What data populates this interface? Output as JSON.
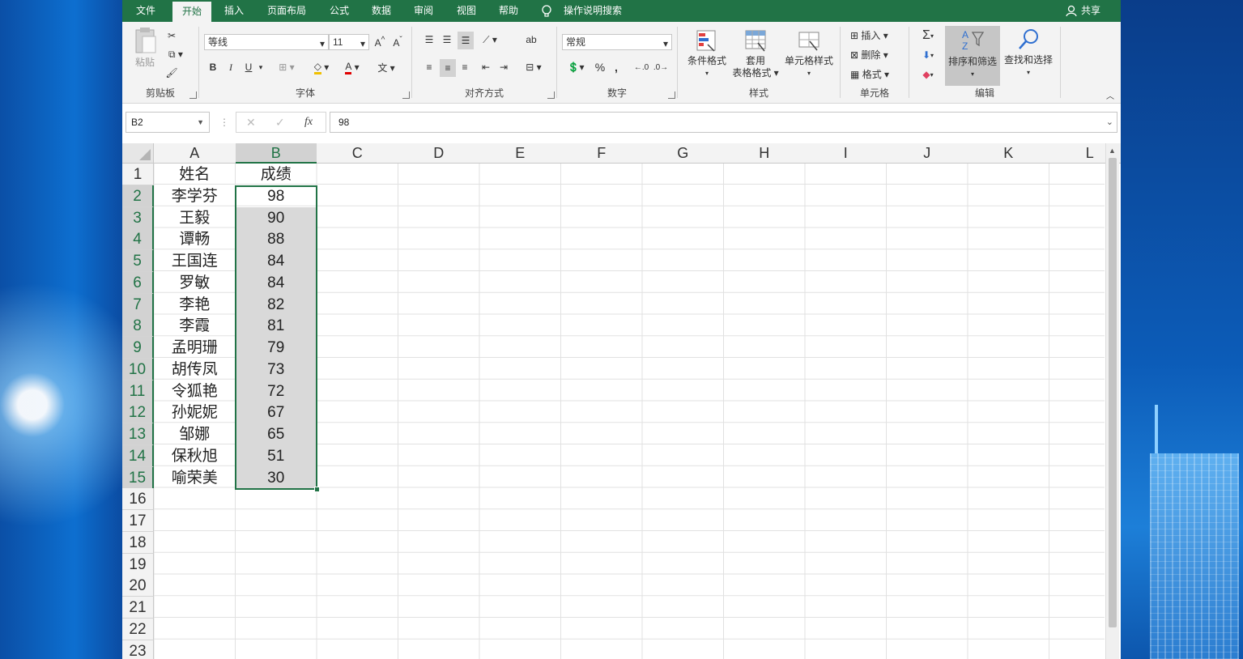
{
  "tabs": [
    {
      "label": "文件",
      "active": false
    },
    {
      "label": "开始",
      "active": true
    },
    {
      "label": "插入",
      "active": false
    },
    {
      "label": "页面布局",
      "active": false
    },
    {
      "label": "公式",
      "active": false
    },
    {
      "label": "数据",
      "active": false
    },
    {
      "label": "审阅",
      "active": false
    },
    {
      "label": "视图",
      "active": false
    },
    {
      "label": "帮助",
      "active": false
    }
  ],
  "tell_me": "操作说明搜索",
  "share": "共享",
  "ribbon": {
    "clipboard": {
      "label": "剪贴板",
      "paste": "粘贴"
    },
    "font": {
      "label": "字体",
      "font_name": "等线",
      "font_size": "11",
      "bold": "B",
      "italic": "I",
      "underline": "U"
    },
    "alignment": {
      "label": "对齐方式"
    },
    "number": {
      "label": "数字",
      "format": "常规",
      "percent": "%",
      "comma": ","
    },
    "styles": {
      "label": "样式",
      "conditional": "条件格式",
      "table_format_1": "套用",
      "table_format_2": "表格格式",
      "cell_styles": "单元格样式"
    },
    "cells": {
      "label": "单元格",
      "insert": "插入",
      "delete": "删除",
      "format": "格式"
    },
    "editing": {
      "label": "编辑",
      "sort_filter": "排序和筛选",
      "find_select": "查找和选择"
    }
  },
  "formula_bar": {
    "name_box": "B2",
    "fx": "fx",
    "value": "98"
  },
  "columns": [
    "A",
    "B",
    "C",
    "D",
    "E",
    "F",
    "G",
    "H",
    "I",
    "J",
    "K",
    "L"
  ],
  "rows": [
    "1",
    "2",
    "3",
    "4",
    "5",
    "6",
    "7",
    "8",
    "9",
    "10",
    "11",
    "12",
    "13",
    "14",
    "15",
    "16",
    "17",
    "18",
    "19",
    "20",
    "21",
    "22",
    "23"
  ],
  "sheet": {
    "header": {
      "name": "姓名",
      "score": "成绩"
    },
    "records": [
      {
        "name": "李学芬",
        "score": "98"
      },
      {
        "name": "王毅",
        "score": "90"
      },
      {
        "name": "谭畅",
        "score": "88"
      },
      {
        "name": "王国连",
        "score": "84"
      },
      {
        "name": "罗敏",
        "score": "84"
      },
      {
        "name": "李艳",
        "score": "82"
      },
      {
        "name": "李霞",
        "score": "81"
      },
      {
        "name": "孟明珊",
        "score": "79"
      },
      {
        "name": "胡传凤",
        "score": "73"
      },
      {
        "name": "令狐艳",
        "score": "72"
      },
      {
        "name": "孙妮妮",
        "score": "67"
      },
      {
        "name": "邹娜",
        "score": "65"
      },
      {
        "name": "保秋旭",
        "score": "51"
      },
      {
        "name": "喻荣美",
        "score": "30"
      }
    ]
  },
  "colors": {
    "accent": "#217346",
    "selection": "#d9d9d9"
  }
}
